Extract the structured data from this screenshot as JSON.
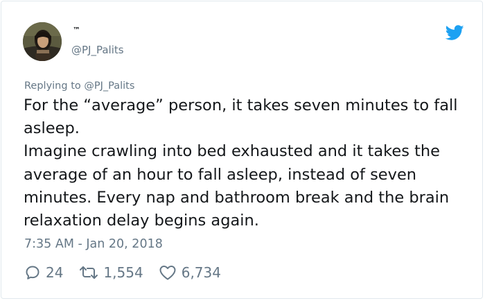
{
  "tweet": {
    "author": {
      "display_name": "™",
      "handle": "@PJ_Palits",
      "avatar_icon": "avatar-portrait"
    },
    "logo_icon": "twitter-bird-icon",
    "brand_color": "#1da1f2",
    "replying_to": {
      "prefix": "Replying to",
      "mention": "@PJ_Palits"
    },
    "text_lines": [
      "For the “average” person, it takes seven minutes to fall asleep.",
      "Imagine crawling into bed exhausted and it takes the average of an hour to fall asleep, instead of seven minutes. Every nap and bathroom break and the brain relaxation delay begins again."
    ],
    "timestamp": "7:35 AM - Jan 20, 2018",
    "stats": {
      "replies": "24",
      "retweets": "1,554",
      "likes": "6,734"
    },
    "action_icons": [
      "reply-icon",
      "retweet-icon",
      "like-icon"
    ]
  }
}
